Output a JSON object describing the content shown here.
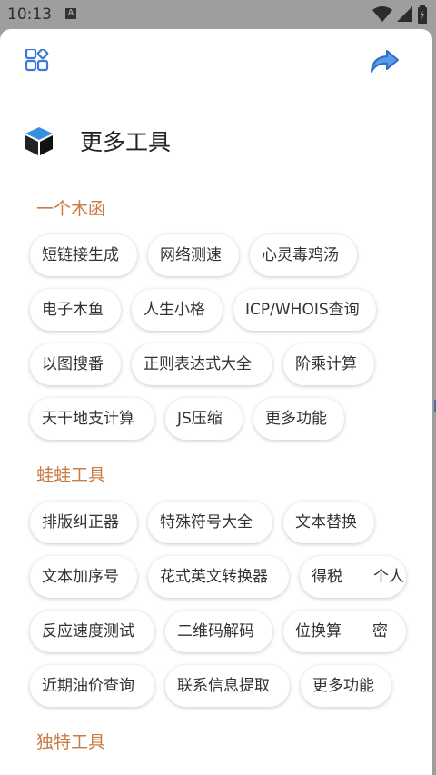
{
  "status_bar": {
    "time": "10:13",
    "notification_badge": "A"
  },
  "page": {
    "title": "更多工具"
  },
  "sections": [
    {
      "title": "一个木函",
      "items": [
        "短链接生成",
        "网络测速",
        "心灵毒鸡汤",
        "电子木鱼",
        "人生小格",
        "ICP/WHOIS查询",
        "以图搜番",
        "正则表达式大全",
        "阶乘计算",
        "天干地支计算",
        "JS压缩",
        "更多功能"
      ]
    },
    {
      "title": "蛙蛙工具",
      "items": [
        "排版纠正器",
        "特殊符号大全",
        "文本替换",
        "文本加序号",
        "花式英文转换器",
        "得税　　个人",
        "反应速度测试",
        "二维码解码",
        "位换算　　密",
        "近期油价查询",
        "联系信息提取",
        "更多功能"
      ]
    },
    {
      "title": "独特工具",
      "items": []
    }
  ],
  "colors": {
    "accent": "#c97d45",
    "icon_blue": "#3a7bd5"
  },
  "icons": {
    "top_left": "apps-icon",
    "top_right": "share-icon",
    "title": "box-icon"
  }
}
